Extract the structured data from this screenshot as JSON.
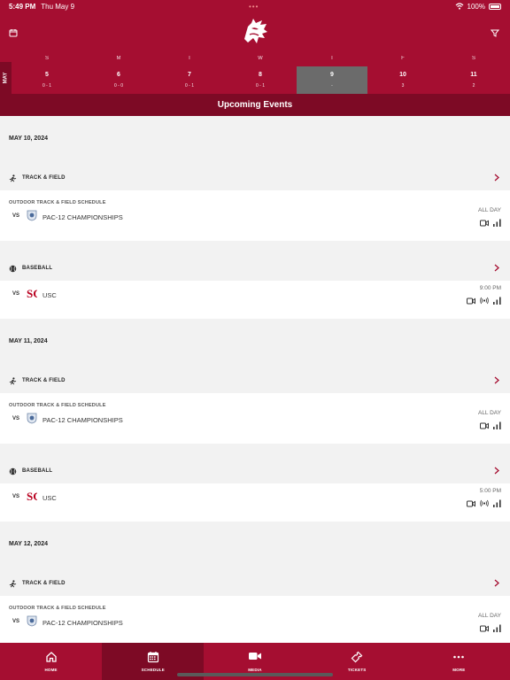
{
  "status_bar": {
    "time": "5:49 PM",
    "date": "Thu May 9",
    "battery": "100%"
  },
  "week": {
    "month_label": "MAY",
    "days": [
      {
        "dow": "S",
        "num": "5",
        "record": "0 - 1"
      },
      {
        "dow": "M",
        "num": "6",
        "record": "0 - 0"
      },
      {
        "dow": "T",
        "num": "7",
        "record": "0 - 1"
      },
      {
        "dow": "W",
        "num": "8",
        "record": "0 - 1"
      },
      {
        "dow": "T",
        "num": "9",
        "record": "-",
        "selected": true
      },
      {
        "dow": "F",
        "num": "10",
        "record": "3"
      },
      {
        "dow": "S",
        "num": "11",
        "record": "2"
      }
    ]
  },
  "section_title": "Upcoming Events",
  "feed": {
    "dates": [
      "MAY 10, 2024",
      "MAY 11, 2024",
      "MAY 12, 2024"
    ],
    "sports": {
      "track": "TRACK & FIELD",
      "baseball": "BASEBALL"
    },
    "events": [
      {
        "schedule": "OUTDOOR TRACK & FIELD SCHEDULE",
        "vs": "VS",
        "opponent": "PAC-12 CHAMPIONSHIPS",
        "time": "ALL DAY"
      },
      {
        "schedule": "",
        "vs": "VS",
        "opponent": "USC",
        "time": "9:00 PM"
      },
      {
        "schedule": "OUTDOOR TRACK & FIELD SCHEDULE",
        "vs": "VS",
        "opponent": "PAC-12 CHAMPIONSHIPS",
        "time": "ALL DAY"
      },
      {
        "schedule": "",
        "vs": "VS",
        "opponent": "USC",
        "time": "5:00 PM"
      },
      {
        "schedule": "OUTDOOR TRACK & FIELD SCHEDULE",
        "vs": "VS",
        "opponent": "PAC-12 CHAMPIONSHIPS",
        "time": "ALL DAY"
      }
    ]
  },
  "tabs": [
    {
      "label": "HOME",
      "icon": "home-icon"
    },
    {
      "label": "SCHEDULE",
      "icon": "calendar-icon",
      "active": true
    },
    {
      "label": "MEDIA",
      "icon": "video-icon"
    },
    {
      "label": "TICKETS",
      "icon": "ticket-icon"
    },
    {
      "label": "MORE",
      "icon": "more-icon"
    }
  ],
  "colors": {
    "primary": "#a50e31",
    "dark": "#7d0a25",
    "selected_day": "#6b6b6b",
    "usc": "#b8001f"
  }
}
